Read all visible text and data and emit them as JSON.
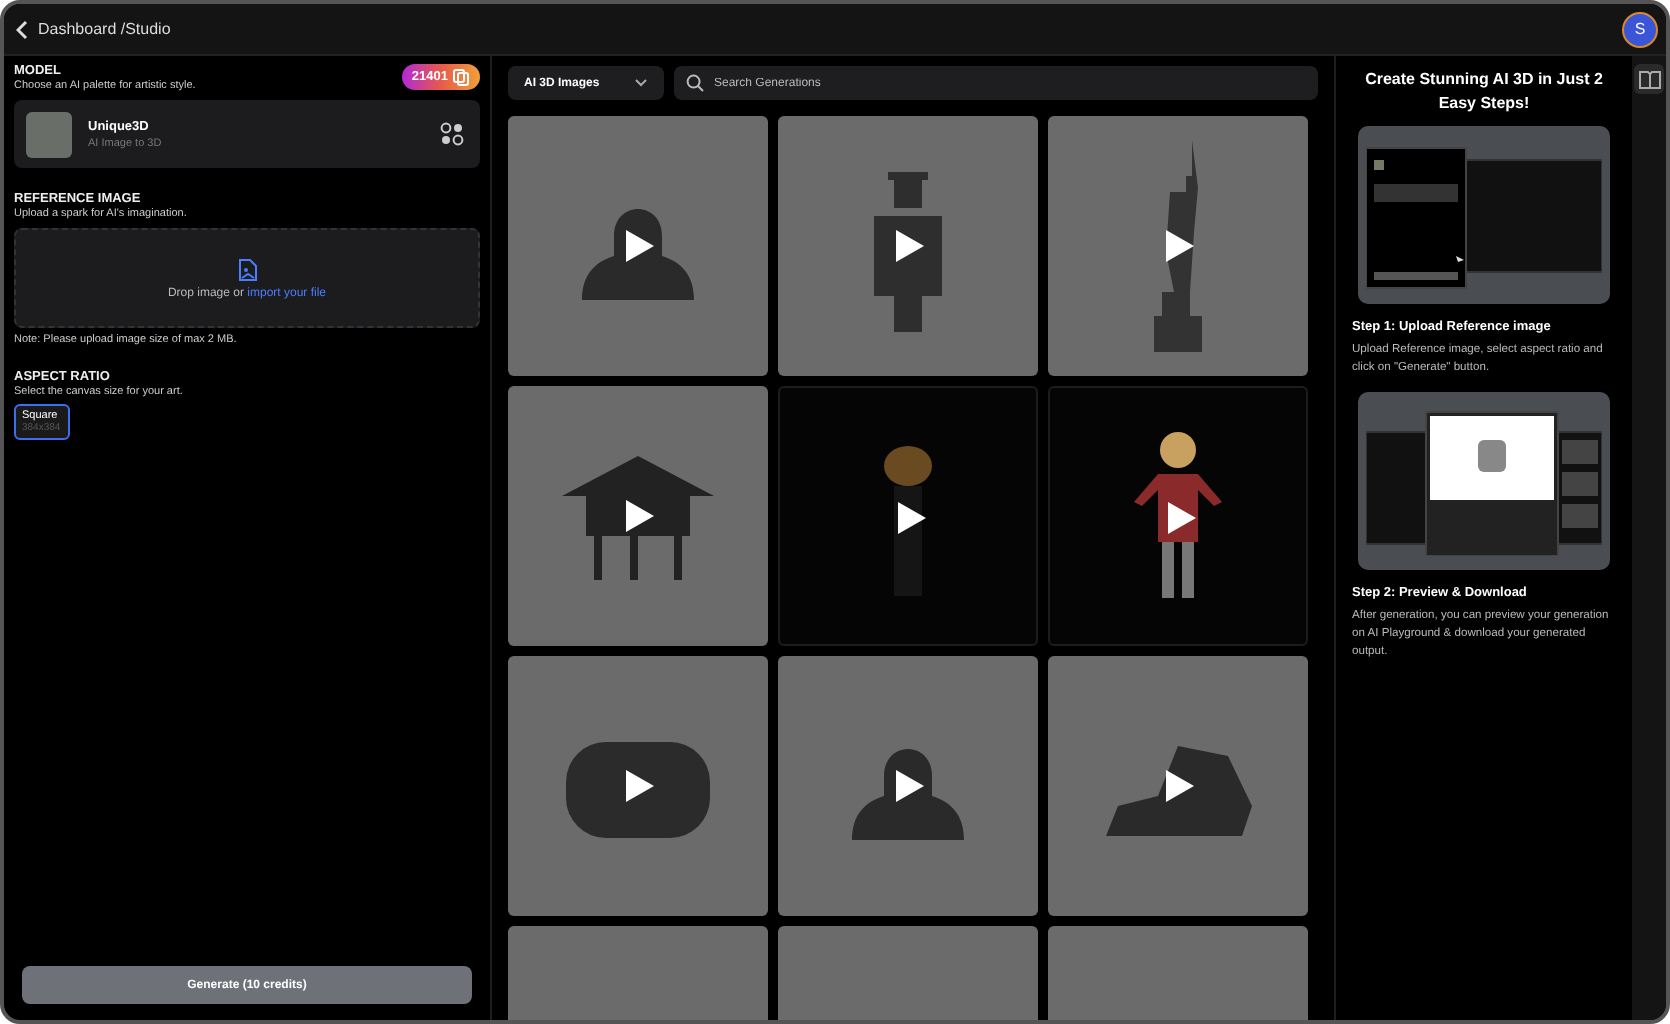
{
  "header": {
    "back_label": "Dashboard /Studio",
    "avatar_initial": "S"
  },
  "model": {
    "heading": "MODEL",
    "subtitle": "Choose an AI palette for artistic style.",
    "credits": "21401",
    "name": "Unique3D",
    "description": "AI Image to 3D"
  },
  "reference_image": {
    "heading": "REFERENCE IMAGE",
    "subtitle": "Upload a spark for AI's imagination.",
    "drop_text": "Drop image or",
    "link": "import your file",
    "note": "Note: Please upload image size of max 2 MB."
  },
  "aspect_ratio": {
    "heading": "ASPECT RATIO",
    "subtitle": "Select the canvas size for your art.",
    "options": [
      {
        "label": "Square",
        "size": "384x384",
        "selected": true
      }
    ]
  },
  "generate_button": "Generate (10 credits)",
  "toolbar": {
    "filter": "AI 3D Images",
    "search_placeholder": "Search Generations"
  },
  "tiles": [
    {
      "kind": "bust",
      "dark": false
    },
    {
      "kind": "figure",
      "dark": false
    },
    {
      "kind": "statue",
      "dark": false
    },
    {
      "kind": "hut",
      "dark": false
    },
    {
      "kind": "glow",
      "dark": true
    },
    {
      "kind": "character",
      "dark": true
    },
    {
      "kind": "cushion",
      "dark": false
    },
    {
      "kind": "bust",
      "dark": false
    },
    {
      "kind": "rock",
      "dark": false
    },
    {
      "kind": "blank",
      "dark": false
    },
    {
      "kind": "blank",
      "dark": false
    },
    {
      "kind": "blank",
      "dark": false
    }
  ],
  "guide": {
    "title": "Create Stunning AI 3D in Just 2 Easy Steps!",
    "steps": [
      {
        "kind": "upload",
        "title": "Step 1: Upload Reference image",
        "text": "Upload Reference image, select aspect ratio and click on \"Generate\" button."
      },
      {
        "kind": "preview",
        "title": "Step 2: Preview & Download",
        "text": "After generation, you can preview your generation on AI Playground & download your generated output."
      }
    ]
  }
}
